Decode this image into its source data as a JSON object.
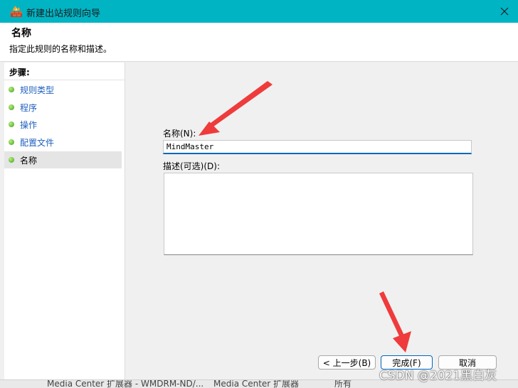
{
  "window": {
    "title": "新建出站规则向导",
    "close_glyph": "✕"
  },
  "header": {
    "title": "名称",
    "subtitle": "指定此规则的名称和描述。"
  },
  "steps": {
    "heading": "步骤:",
    "items": [
      {
        "label": "规则类型"
      },
      {
        "label": "程序"
      },
      {
        "label": "操作"
      },
      {
        "label": "配置文件"
      },
      {
        "label": "名称"
      }
    ],
    "current_index": 4
  },
  "form": {
    "name_label": "名称(N):",
    "name_value": "MindMaster",
    "description_label": "描述(可选)(D):",
    "description_value": ""
  },
  "buttons": {
    "back": "< 上一步(B)",
    "finish": "完成(F)",
    "cancel": "取消"
  },
  "background_row": {
    "col1": "Media Center 扩展器 - WMDRM-ND/...",
    "col2": "Media Center 扩展器",
    "col3": "所有"
  },
  "watermark": "CSDN @2021黑白灰",
  "colors": {
    "titlebar": "#00b4c4",
    "annotation_arrow": "#ef3b3b",
    "focus_underline": "#0067c0",
    "step_link": "#1f5fbf"
  },
  "icons": {
    "app": "firewall-icon",
    "step_marker": "green-dot-icon"
  }
}
